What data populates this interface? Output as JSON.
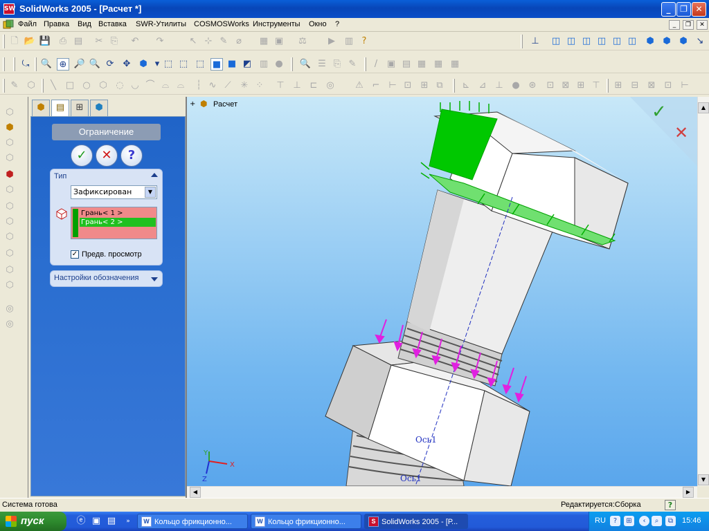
{
  "window": {
    "title": "SolidWorks 2005 - [Расчет *]",
    "app_icon": "SW"
  },
  "title_buttons": {
    "minimize": "_",
    "restore": "❐",
    "close": "✕"
  },
  "menu": [
    "Файл",
    "Правка",
    "Вид",
    "Вставка",
    "SWR-Утилиты",
    "COSMOSWorks",
    "Инструменты",
    "Окно",
    "?"
  ],
  "mdi_buttons": {
    "minimize": "_",
    "restore": "❐",
    "close": "✕"
  },
  "panel": {
    "title": "Ограничение",
    "ok": "✓",
    "cancel": "✕",
    "help": "?",
    "type_group": {
      "header": "Тип",
      "selected": "Зафиксирован",
      "faces": [
        "Грань< 1 >",
        "Грань< 2 >"
      ],
      "preview_label": "Предв. просмотр",
      "preview_checked": true
    },
    "symbol_group": {
      "header": "Настройки обозначения"
    }
  },
  "viewport": {
    "tree_item": "Расчет",
    "axis_labels": [
      "Ось1",
      "Ось1"
    ],
    "triad": {
      "x": "X",
      "y": "Y",
      "z": "Z"
    }
  },
  "status": {
    "left": "Система готова",
    "right": "Редактируется:Сборка"
  },
  "taskbar": {
    "start": "пуск",
    "tasks": [
      {
        "label": "Кольцо фрикционно...",
        "icon": "W",
        "active": false
      },
      {
        "label": "Кольцо фрикционно...",
        "icon": "W",
        "active": false
      },
      {
        "label": "SolidWorks 2005 - [Р...",
        "icon": "S",
        "active": true
      }
    ],
    "lang": "RU",
    "clock": "15:46"
  },
  "colors": {
    "title_bar": "#0846b8",
    "fixed_face": "#00c800",
    "restraint_arrows": "#e020e0",
    "viewport_sky": "#74b8f0"
  }
}
